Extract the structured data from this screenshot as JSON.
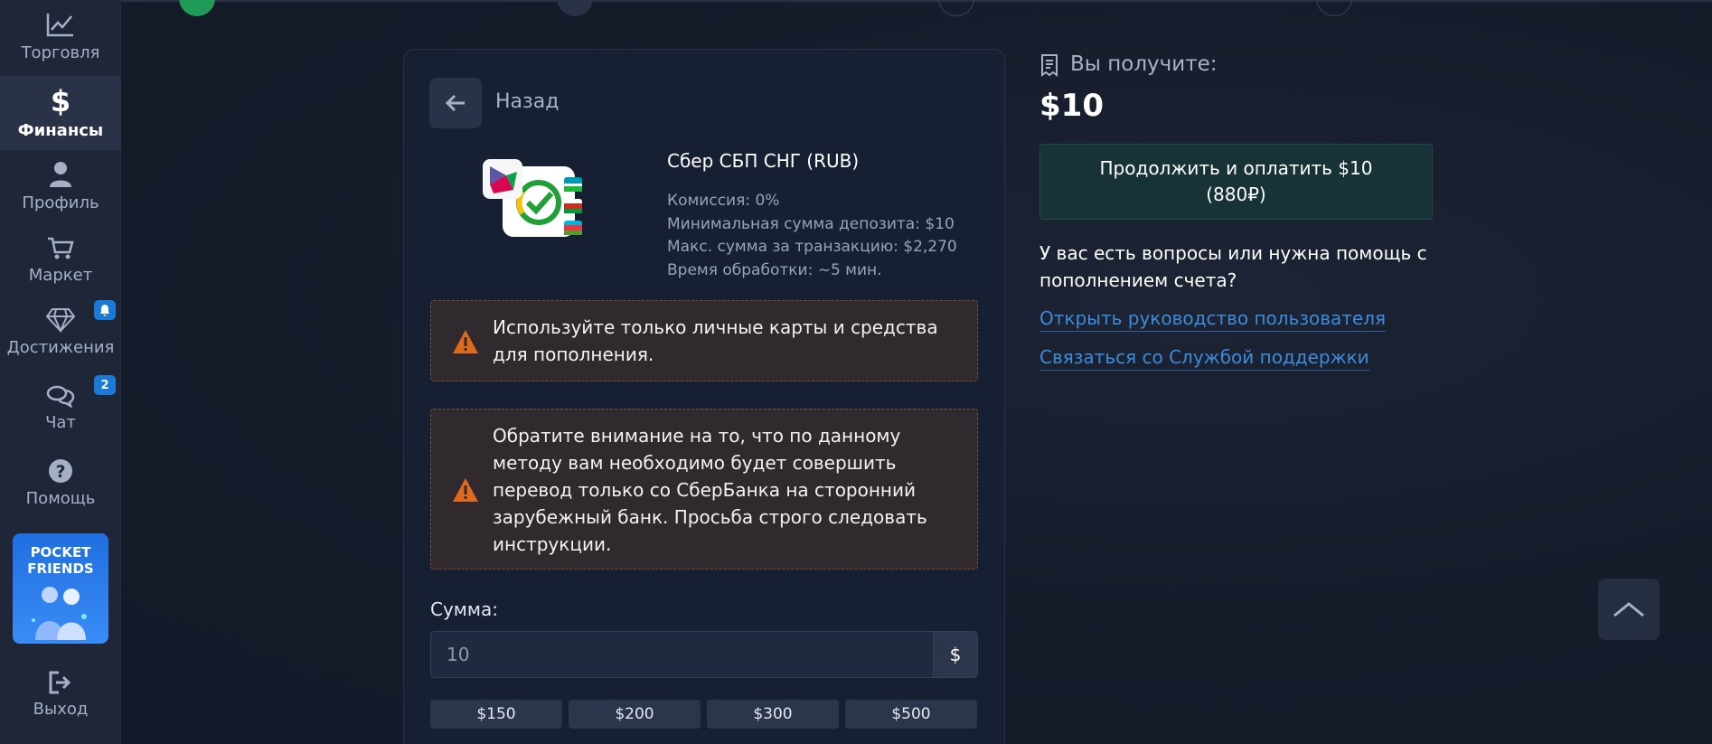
{
  "sidebar": {
    "items": [
      {
        "label": "Торговля",
        "icon": "chart-line-icon"
      },
      {
        "label": "Финансы",
        "icon": "dollar-icon"
      },
      {
        "label": "Профиль",
        "icon": "user-icon"
      },
      {
        "label": "Маркет",
        "icon": "cart-icon"
      },
      {
        "label": "Достижения",
        "icon": "diamond-icon"
      },
      {
        "label": "Чат",
        "icon": "chat-icon"
      },
      {
        "label": "Помощь",
        "icon": "help-icon"
      }
    ],
    "chat_badge": "2",
    "promo": {
      "title_line1": "POCKET",
      "title_line2": "FRIENDS"
    },
    "logout_label": "Выход"
  },
  "deposit": {
    "back_label": "Назад",
    "method": {
      "name": "Сбер СБП СНГ (RUB)",
      "commission": "Комиссия: 0%",
      "min_deposit": "Минимальная сумма депозита: $10",
      "max_transaction": "Макс. сумма за транзакцию: $2,270",
      "processing_time": "Время обработки: ~5 мин."
    },
    "alerts": [
      {
        "line1": "Используйте только личные карты и средства",
        "line2": "для пополнения."
      },
      {
        "line1": "Обратите внимание на то, что по данному",
        "line2": "методу вам необходимо будет совершить",
        "line3": "перевод только со СберБанка на сторонний",
        "line4": "зарубежный банк. Просьба строго следовать",
        "line5": "инструкции."
      }
    ],
    "amount_label": "Сумма:",
    "amount_value": "10",
    "currency_symbol": "$",
    "presets": [
      "$150",
      "$200",
      "$300",
      "$500"
    ]
  },
  "summary": {
    "receive_label": "Вы получите:",
    "receive_amount": "$10",
    "pay_button_line1": "Продолжить и оплатить $10",
    "pay_button_line2": "(880₽)",
    "help_question": "У вас есть вопросы или нужна помощь с пополнением счета?",
    "guide_link": "Открыть руководство пользователя",
    "support_link": "Связаться со Службой поддержки"
  },
  "colors": {
    "accent": "#1b7ad6",
    "link": "#3d8bd9",
    "alert_border": "#7a4e35",
    "warning_icon": "#e06a1c"
  }
}
